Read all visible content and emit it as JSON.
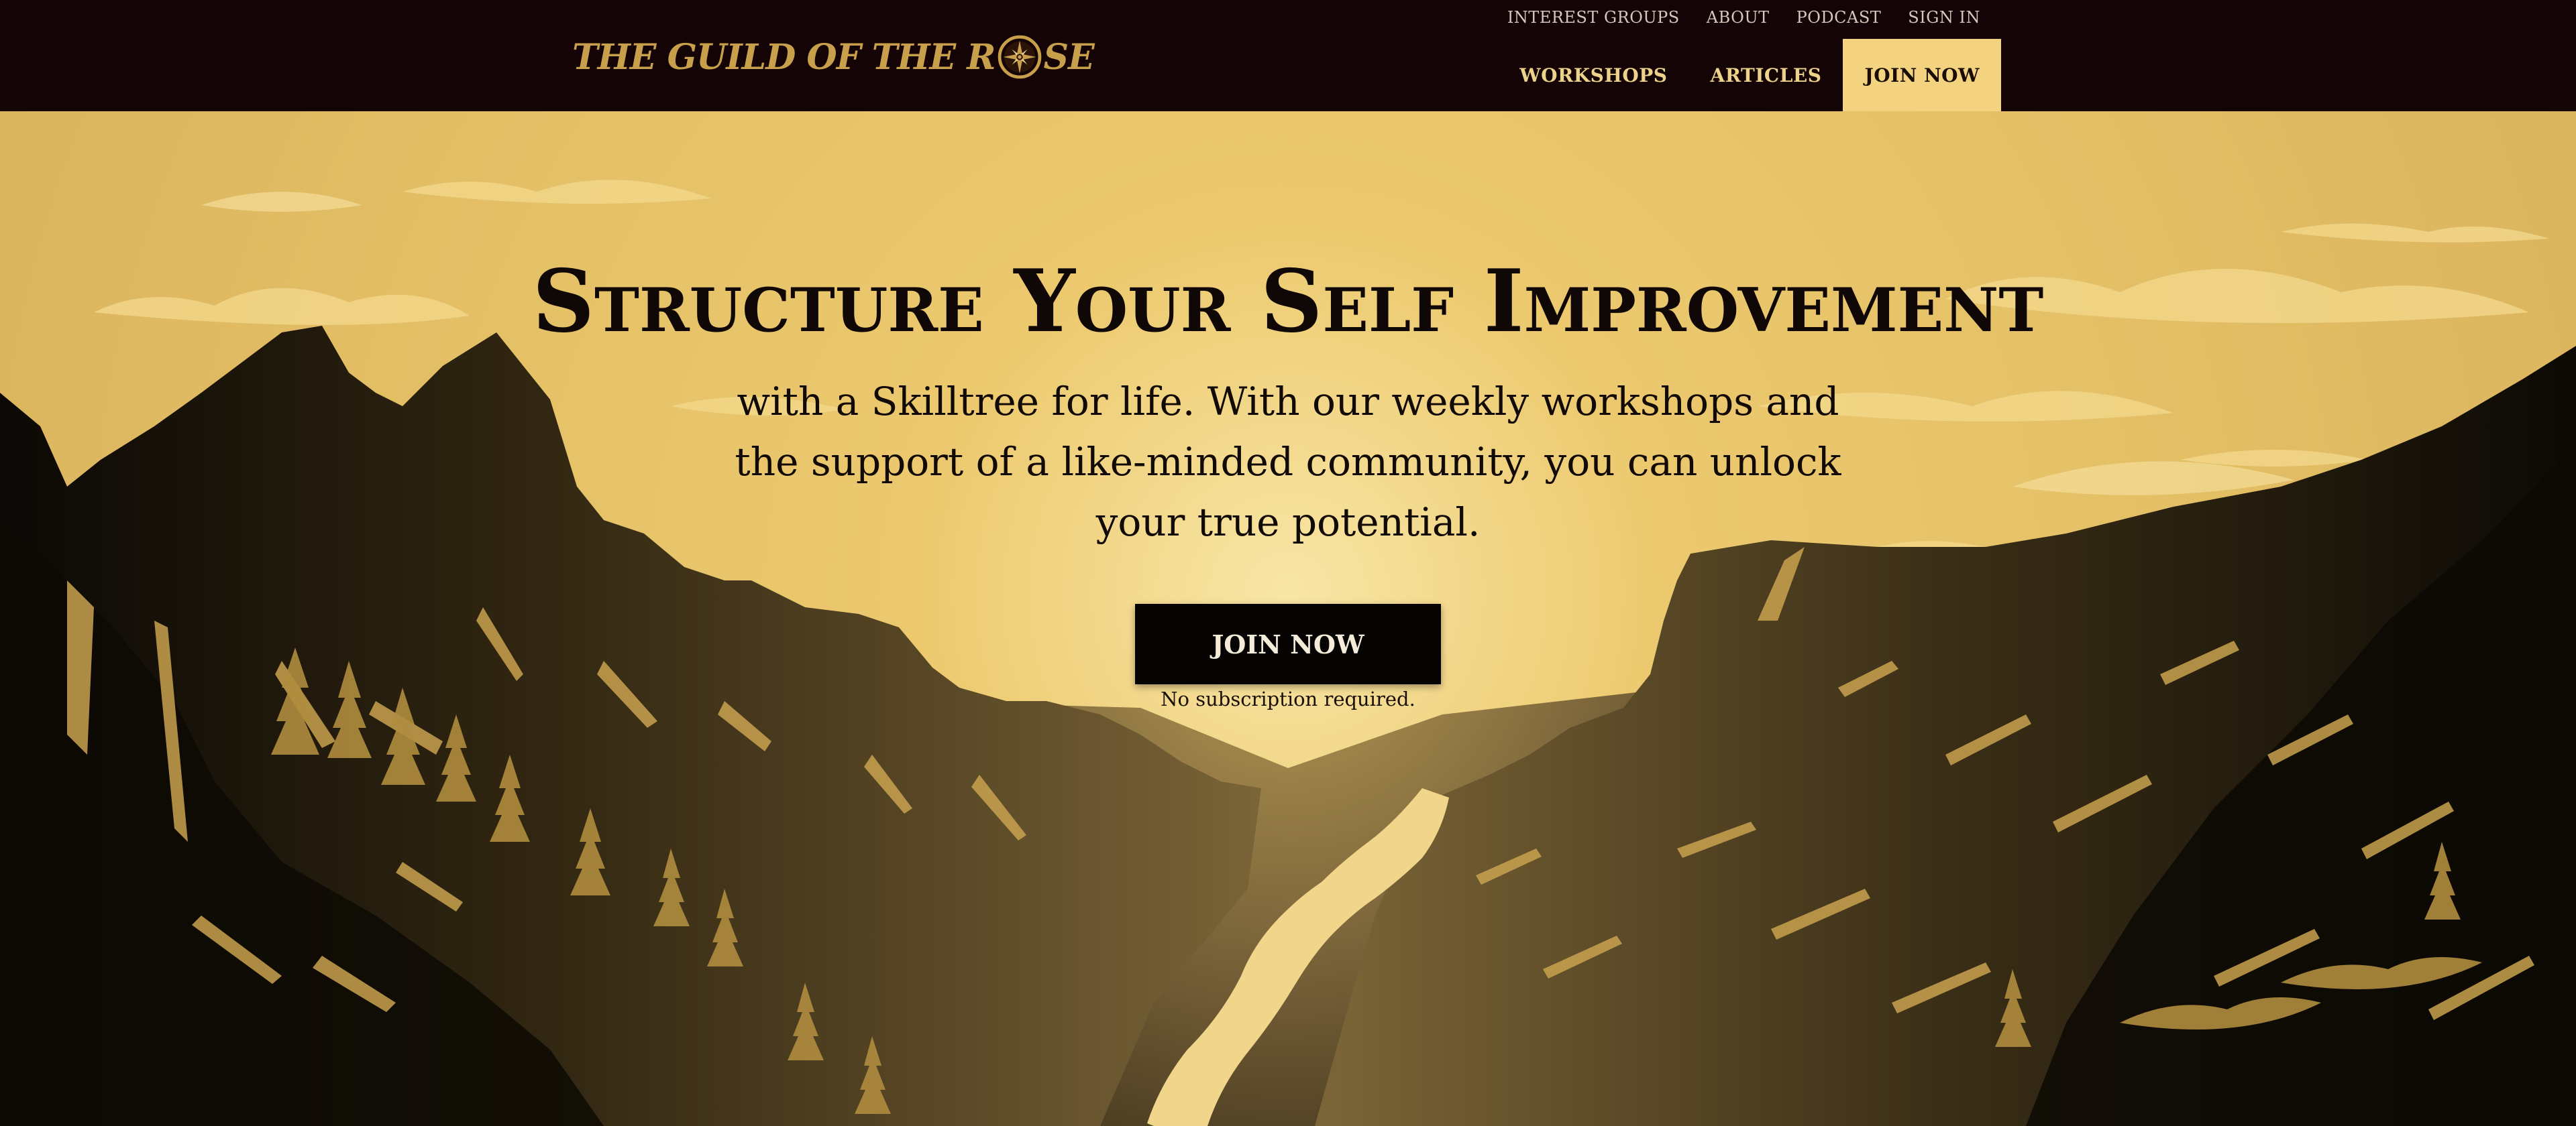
{
  "brand": {
    "name_before": "THE GUILD OF THE R",
    "name_after": "SE",
    "logo_icon": "compass-rose-icon",
    "color": "#c8a04c"
  },
  "header": {
    "utility_links": [
      "INTEREST GROUPS",
      "ABOUT",
      "PODCAST",
      "SIGN IN"
    ],
    "main_links": {
      "workshops": "WORKSHOPS",
      "articles": "ARTICLES",
      "join": "JOIN NOW"
    },
    "background": "#140405",
    "join_background": "#f3d37f"
  },
  "hero": {
    "headline": "Structure Your Self Improvement",
    "subheadline": "with a Skilltree for life. With our weekly workshops and the support of a like-minded community, you can unlock your true potential.",
    "cta_label": "JOIN NOW",
    "cta_note": "No subscription required.",
    "sky_color": "#e6c36b",
    "mountain_color": "#0e0b06"
  }
}
